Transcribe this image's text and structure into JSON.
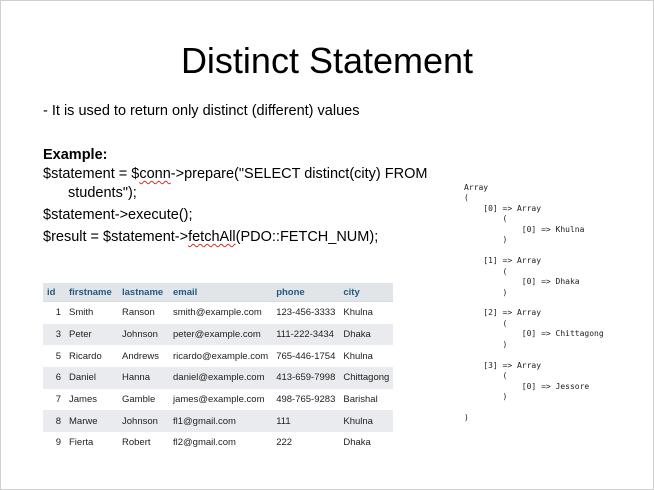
{
  "slide": {
    "title": "Distinct Statement",
    "description": "- It is used to return only distinct (different) values",
    "example_label": "Example:",
    "code": {
      "line1_a": "$statement = $",
      "line1_b": "conn",
      "line1_c": "->prepare(\"SELECT distinct(city) FROM",
      "line1_d": "students\");",
      "line2": "$statement->execute();",
      "line3_a": "$result = $statement->",
      "line3_b": "fetchAll",
      "line3_c": "(PDO::FETCH_NUM);"
    }
  },
  "table": {
    "headers": [
      "id",
      "firstname",
      "lastname",
      "email",
      "phone",
      "city"
    ],
    "rows": [
      [
        "1",
        "Smith",
        "Ranson",
        "smith@example.com",
        "123-456-3333",
        "Khulna"
      ],
      [
        "3",
        "Peter",
        "Johnson",
        "peter@example.com",
        "111-222-3434",
        "Dhaka"
      ],
      [
        "5",
        "Ricardo",
        "Andrews",
        "ricardo@example.com",
        "765-446-1754",
        "Khulna"
      ],
      [
        "6",
        "Daniel",
        "Hanna",
        "daniel@example.com",
        "413-659-7998",
        "Chittagong"
      ],
      [
        "7",
        "James",
        "Gamble",
        "james@example.com",
        "498-765-9283",
        "Barishal"
      ],
      [
        "8",
        "Marwe",
        "Johnson",
        "fl1@gmail.com",
        "111",
        "Khulna"
      ],
      [
        "9",
        "Fierta",
        "Robert",
        "fl2@gmail.com",
        "222",
        "Dhaka"
      ]
    ]
  },
  "output": "Array\n(\n    [0] => Array\n        (\n            [0] => Khulna\n        )\n\n    [1] => Array\n        (\n            [0] => Dhaka\n        )\n\n    [2] => Array\n        (\n            [0] => Chittagong\n        )\n\n    [3] => Array\n        (\n            [0] => Jessore\n        )\n\n)"
}
